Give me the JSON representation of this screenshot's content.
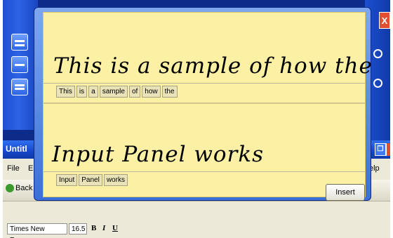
{
  "app_window": {
    "title": "Untitl",
    "menu_file": "File",
    "menu_edit": "E",
    "menu_help": "elp",
    "back_label": "Back",
    "font_name": "Times New Roman",
    "font_size": "16.5",
    "fmt_bold": "B",
    "fmt_italic": "I",
    "fmt_underline": "U"
  },
  "input_panel": {
    "lines": [
      {
        "ink": "This is a sample of how the",
        "words": [
          "This",
          "is",
          "a",
          "sample",
          "of",
          "how",
          "the"
        ]
      },
      {
        "ink": "Input Panel works",
        "words": [
          "Input",
          "Panel",
          "works"
        ]
      }
    ],
    "insert_label": "Insert"
  },
  "colors": {
    "taskbar_blue": "#1e4fd1",
    "panel_yellow": "#fbf0a3",
    "close_red": "#e05030"
  }
}
